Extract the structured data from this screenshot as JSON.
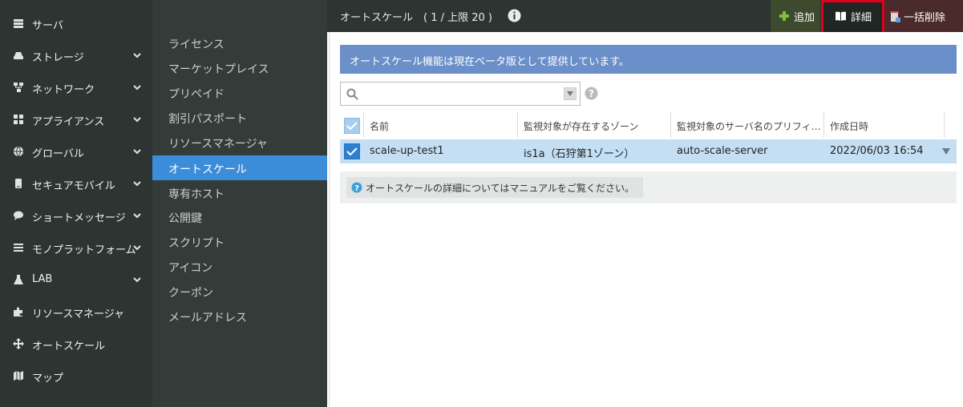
{
  "leftnav": {
    "items": [
      {
        "label": "サーバ",
        "icon": "server-icon",
        "chevron": false
      },
      {
        "label": "ストレージ",
        "icon": "storage-icon",
        "chevron": true
      },
      {
        "label": "ネットワーク",
        "icon": "network-icon",
        "chevron": true
      },
      {
        "label": "アプライアンス",
        "icon": "appliance-icon",
        "chevron": true
      },
      {
        "label": "グローバル",
        "icon": "globe-icon",
        "chevron": true
      },
      {
        "label": "セキュアモバイル",
        "icon": "mobile-icon",
        "chevron": true
      },
      {
        "label": "ショートメッセージ",
        "icon": "chat-icon",
        "chevron": true
      },
      {
        "label": "モノプラットフォーム",
        "icon": "list-icon",
        "chevron": true
      },
      {
        "label": "LAB",
        "icon": "flask-icon",
        "chevron": true
      },
      {
        "label": "リソースマネージャ",
        "icon": "puzzle-icon",
        "chevron": false
      },
      {
        "label": "オートスケール",
        "icon": "move-arrows-icon",
        "chevron": false
      },
      {
        "label": "マップ",
        "icon": "map-icon",
        "chevron": false
      }
    ]
  },
  "subnav": {
    "items": [
      "ライセンス",
      "マーケットプレイス",
      "プリペイド",
      "割引パスポート",
      "リソースマネージャ",
      "オートスケール",
      "専有ホスト",
      "公開鍵",
      "スクリプト",
      "アイコン",
      "クーポン",
      "メールアドレス"
    ],
    "active_index": 5
  },
  "header": {
    "title": "オートスケール",
    "count": "( 1 / 上限 20 )",
    "add_label": "追加",
    "detail_label": "詳細",
    "bulk_delete_label": "一括削除"
  },
  "main": {
    "beta_banner": "オートスケール機能は現在ベータ版として提供しています。",
    "search": {
      "value": "",
      "placeholder": ""
    },
    "columns": [
      "名前",
      "監視対象が存在するゾーン",
      "監視対象のサーバ名のプリフィ…",
      "作成日時"
    ],
    "rows": [
      {
        "name": "scale-up-test1",
        "zone": "is1a（石狩第1ゾーン）",
        "prefix": "auto-scale-server",
        "created": "2022/06/03 16:54",
        "checked": true
      }
    ],
    "hint": "オートスケールの詳細についてはマニュアルをご覧ください。"
  },
  "colors": {
    "nav_bg": "#2d3532",
    "subnav_bg": "#343c39",
    "active_blue": "#3b8dd9",
    "banner_blue": "#6b8fc9",
    "row_selected": "#c4dff3",
    "highlight_red": "#e0001a"
  }
}
